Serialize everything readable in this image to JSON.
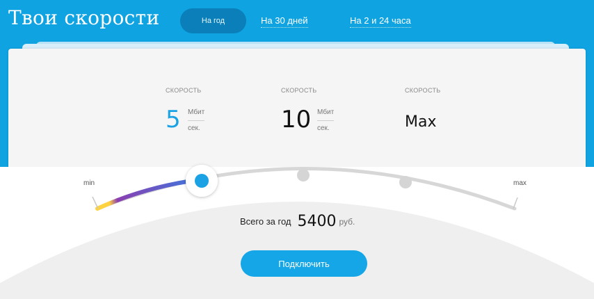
{
  "header": {
    "title": "Твои скорости",
    "tabs": [
      {
        "label": "На год",
        "active": true
      },
      {
        "label": "На 30 дней",
        "active": false
      },
      {
        "label": "На 2 и 24 часа",
        "active": false
      }
    ]
  },
  "speeds": [
    {
      "caption": "СКОРОСТЬ",
      "value": "5",
      "unit_top": "Мбит",
      "unit_bottom": "сек."
    },
    {
      "caption": "СКОРОСТЬ",
      "value": "10",
      "unit_top": "Мбит",
      "unit_bottom": "сек."
    },
    {
      "caption": "СКОРОСТЬ",
      "value": "Max"
    }
  ],
  "slider": {
    "min_label": "min",
    "max_label": "max",
    "selected_index": 0,
    "stops": 3
  },
  "summary": {
    "label": "Всего за год",
    "amount": "5400",
    "currency": "руб."
  },
  "connect_button": {
    "label": "Подключить"
  },
  "colors": {
    "accent": "#1aa2e4",
    "header_bg": "#0fa3e1",
    "active_tab_bg": "#0a7fb9",
    "gradient": [
      "#ffd23f",
      "#8b3fb0",
      "#3b7ae0"
    ]
  }
}
